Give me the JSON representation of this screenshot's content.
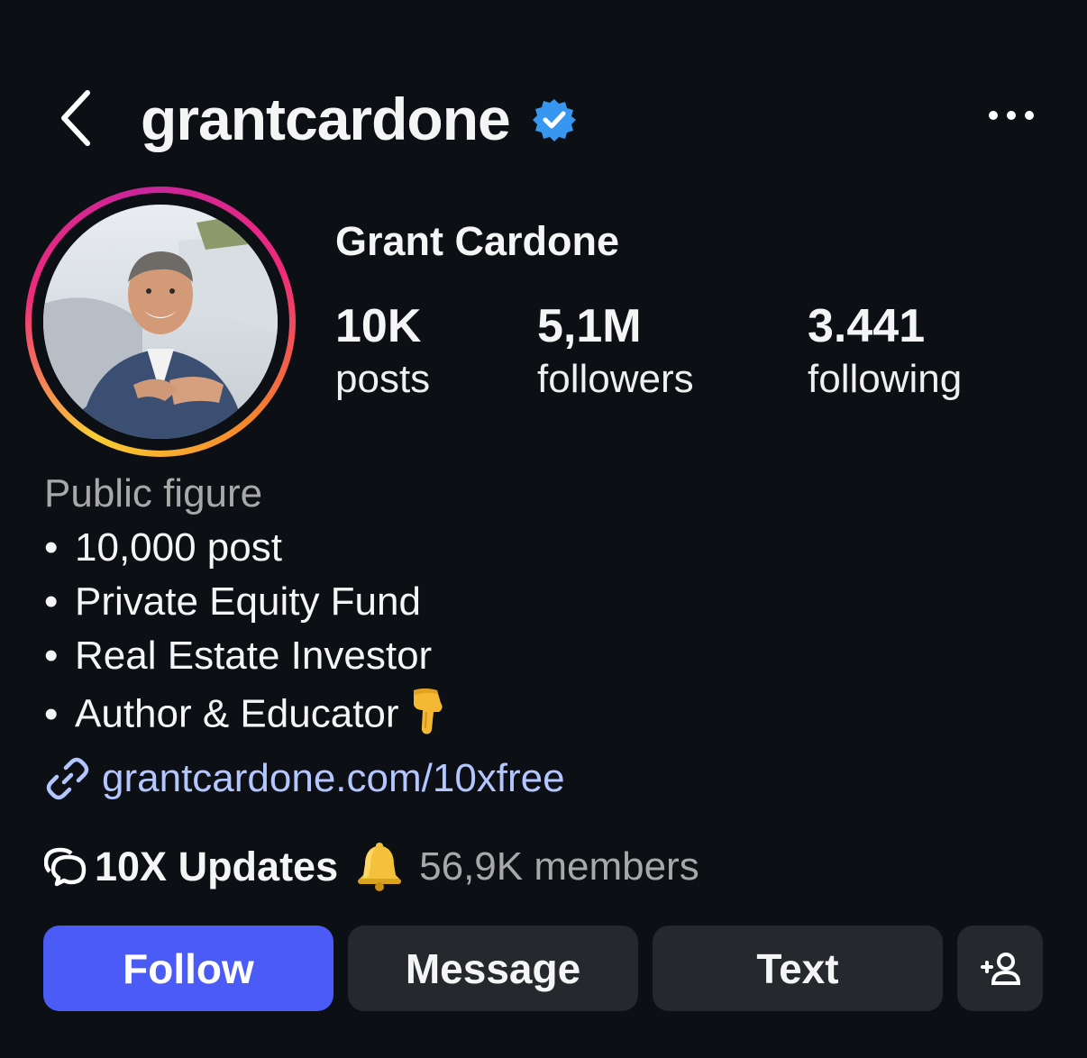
{
  "header": {
    "back_icon": "chevron-left-icon",
    "username": "grantcardone",
    "verified_icon": "verified-badge-icon",
    "more_icon": "more-horizontal-icon"
  },
  "profile": {
    "full_name": "Grant Cardone",
    "avatar": "profile-photo",
    "stats": [
      {
        "value": "10K",
        "label": "posts"
      },
      {
        "value": "5,1M",
        "label": "followers"
      },
      {
        "value": "3.441",
        "label": "following"
      }
    ]
  },
  "bio": {
    "category": "Public figure",
    "bullet": "•",
    "lines": [
      "10,000 post",
      "Private Equity Fund",
      "Real Estate Investor",
      "Author & Educator"
    ],
    "last_line_emoji": "pointing-down-hand-icon"
  },
  "link": {
    "icon": "link-icon",
    "text": "grantcardone.com/10xfree"
  },
  "channel": {
    "icon": "channel-chat-icon",
    "name": "10X Updates",
    "emoji": "bell-icon",
    "members": "56,9K members"
  },
  "actions": {
    "follow": "Follow",
    "message": "Message",
    "text": "Text",
    "add_user_icon": "add-person-icon"
  },
  "colors": {
    "background": "#0c0f14",
    "follow_button": "#4a5cf5",
    "secondary_button": "#25282d",
    "verified_blue": "#3797f0",
    "link": "#b3c6ff",
    "muted_text": "#a8a8a8"
  }
}
